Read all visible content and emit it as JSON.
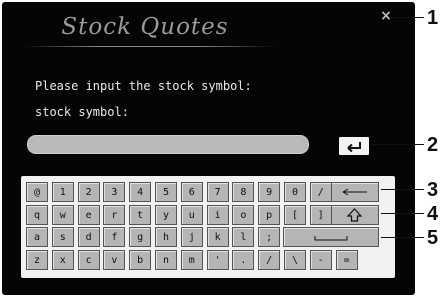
{
  "dialog": {
    "title": "Stock Quotes",
    "close_label": "×",
    "prompt_line1": "Please input the stock symbol:",
    "prompt_line2": "stock symbol:",
    "input_value": ""
  },
  "keyboard": {
    "rows": [
      [
        "@",
        "1",
        "2",
        "3",
        "4",
        "5",
        "6",
        "7",
        "8",
        "9",
        "0",
        "/"
      ],
      [
        "q",
        "w",
        "e",
        "r",
        "t",
        "y",
        "u",
        "i",
        "o",
        "p",
        "[",
        "]"
      ],
      [
        "a",
        "s",
        "d",
        "f",
        "g",
        "h",
        "j",
        "k",
        "l",
        ";"
      ],
      [
        "z",
        "x",
        "c",
        "v",
        "b",
        "n",
        "m",
        "'",
        ".",
        "/",
        "\\",
        "-",
        "="
      ]
    ],
    "special_keys": [
      "backspace",
      "shift",
      "space"
    ]
  },
  "callouts": [
    "1",
    "2",
    "3",
    "4",
    "5"
  ],
  "colors": {
    "screen": "#050505",
    "key": "#b5b5b5",
    "keyboard_bg": "#f2f2f2",
    "input": "#b9b9b9"
  }
}
